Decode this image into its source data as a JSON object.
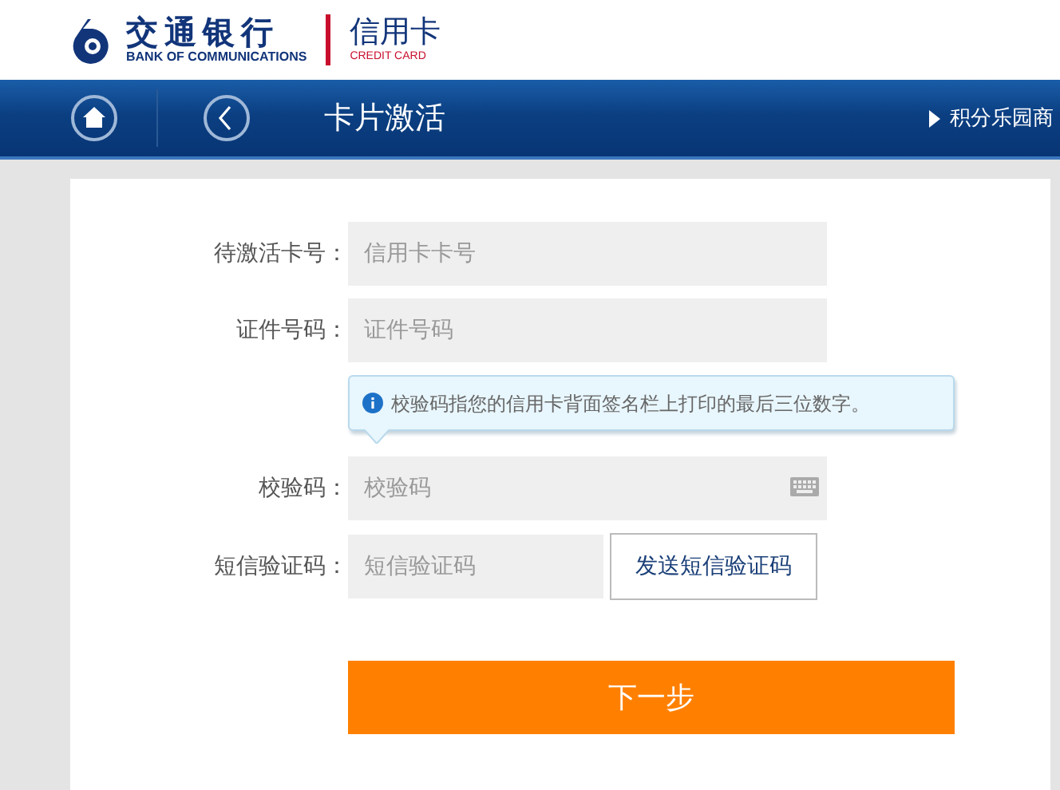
{
  "header": {
    "bank_name": "交通银行",
    "bank_name_en": "BANK OF COMMUNICATIONS",
    "product": "信用卡",
    "product_en": "CREDIT CARD"
  },
  "nav": {
    "title": "卡片激活",
    "link": "积分乐园商"
  },
  "form": {
    "fields": [
      {
        "kind": "text",
        "label": "待激活卡号：",
        "placeholder": "信用卡卡号"
      },
      {
        "kind": "text",
        "label": "证件号码：",
        "placeholder": "证件号码"
      },
      {
        "kind": "tip",
        "text": "校验码指您的信用卡背面签名栏上打印的最后三位数字。"
      },
      {
        "kind": "keyboard",
        "label": "校验码：",
        "placeholder": "校验码"
      },
      {
        "kind": "sms",
        "label": "短信验证码：",
        "placeholder": "短信验证码",
        "button": "发送短信验证码"
      }
    ],
    "submit": "下一步"
  }
}
